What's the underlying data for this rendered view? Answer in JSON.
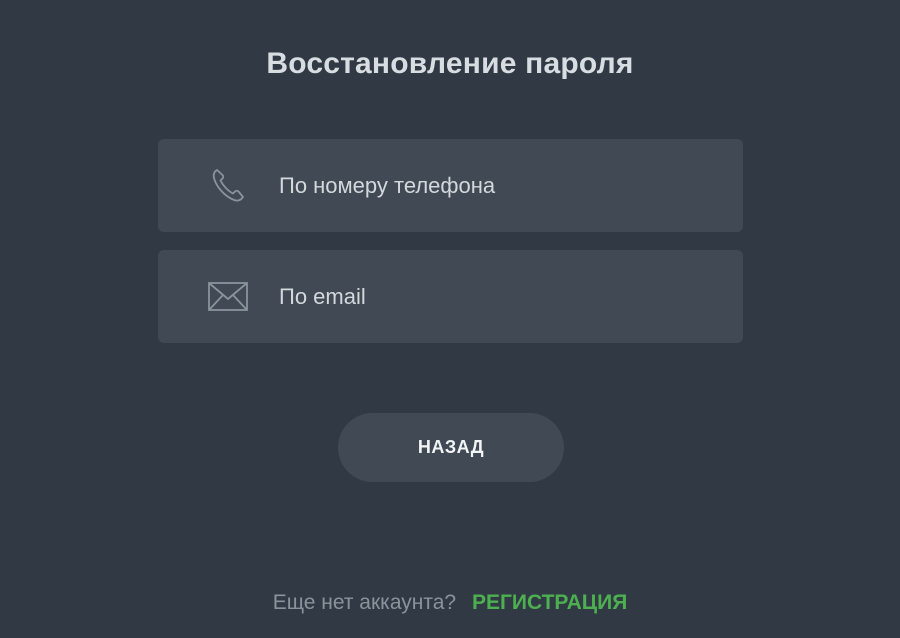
{
  "title": "Восстановление пароля",
  "options": [
    {
      "icon": "phone-icon",
      "label": "По номеру телефона"
    },
    {
      "icon": "envelope-icon",
      "label": "По email"
    }
  ],
  "back_button_label": "НАЗАД",
  "footer": {
    "question": "Еще нет аккаунта?",
    "register_label": "РЕГИСТРАЦИЯ"
  },
  "colors": {
    "background": "#313a44",
    "card": "#414a54",
    "accent": "#4caf50"
  }
}
